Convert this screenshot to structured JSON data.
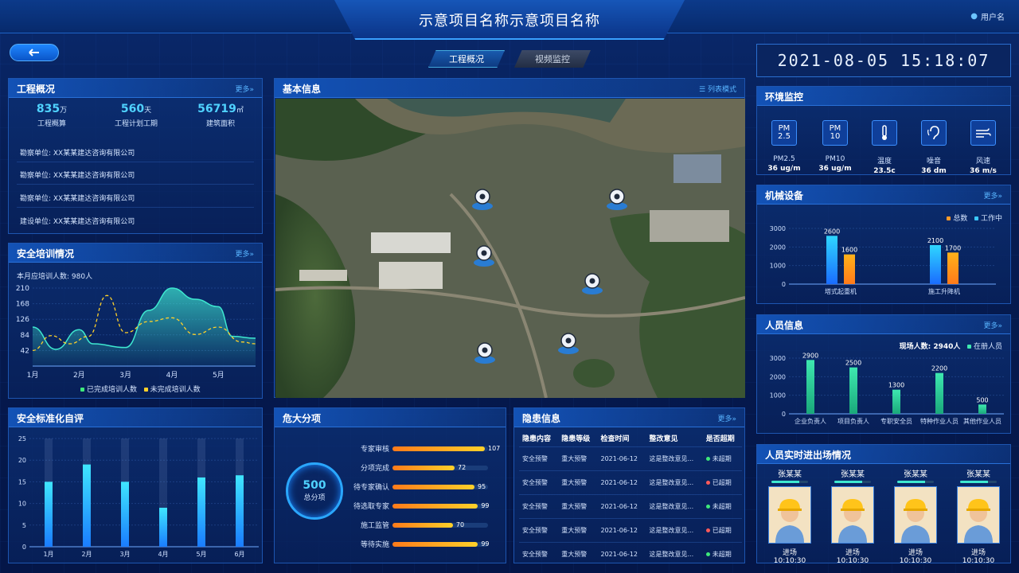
{
  "header": {
    "title": "示意项目名称示意项目名称",
    "user": "用户名"
  },
  "nav": {
    "tab_overview": "工程概况",
    "tab_video": "视频监控"
  },
  "clock": "2021-08-05 15:18:07",
  "overview": {
    "title": "工程概况",
    "more": "更多»",
    "stats": [
      {
        "value": "835",
        "unit": "万",
        "label": "工程概算"
      },
      {
        "value": "560",
        "unit": "天",
        "label": "工程计划工期"
      },
      {
        "value": "56719",
        "unit": "㎡",
        "label": "建筑面积"
      }
    ],
    "rows": [
      "勘察单位:  XX某某建达咨询有限公司",
      "勘察单位:  XX某某建达咨询有限公司",
      "勘察单位:  XX某某建达咨询有限公司",
      "建设单位:  XX某某建达咨询有限公司"
    ]
  },
  "training": {
    "title": "安全培训情况",
    "more": "更多»",
    "note": "本月应培训人数:  980人",
    "legend_done": "已完成培训人数",
    "legend_todo": "未完成培训人数"
  },
  "map": {
    "title": "基本信息",
    "list_mode": "列表模式"
  },
  "env": {
    "title": "环境监控",
    "items": [
      {
        "icon": "PM 2.5",
        "label": "PM2.5",
        "value": "36 ug/m"
      },
      {
        "icon": "PM 10",
        "label": "PM10",
        "value": "36 ug/m"
      },
      {
        "icon": "thermometer-icon",
        "label": "温度",
        "value": "23.5c"
      },
      {
        "icon": "ear-icon",
        "label": "噪音",
        "value": "36 dm"
      },
      {
        "icon": "wind-icon",
        "label": "风速",
        "value": "36 m/s"
      }
    ]
  },
  "machinery": {
    "title": "机械设备",
    "more": "更多»",
    "legend_total": "总数",
    "legend_working": "工作中"
  },
  "personnel": {
    "title": "人员信息",
    "more": "更多»",
    "onsite": "现场人数:  2940人",
    "legend": "在册人员"
  },
  "standard": {
    "title": "安全标准化自评"
  },
  "danger": {
    "title": "危大分项",
    "total_value": "500",
    "total_label": "总分项",
    "items": [
      {
        "label": "专家审核",
        "value": 107
      },
      {
        "label": "分项完成",
        "value": 72
      },
      {
        "label": "待专家确认",
        "value": 95
      },
      {
        "label": "待选取专家",
        "value": 99
      },
      {
        "label": "施工监管",
        "value": 70
      },
      {
        "label": "等待实施",
        "value": 99
      }
    ]
  },
  "hazard": {
    "title": "隐患信息",
    "more": "更多»",
    "headers": [
      "隐患内容",
      "隐患等级",
      "检查时间",
      "整改意见",
      "是否超期"
    ],
    "rows": [
      [
        "安全预警",
        "重大预警",
        "2021-06-12",
        "这是整改意见...",
        "未超期"
      ],
      [
        "安全预警",
        "重大预警",
        "2021-06-12",
        "这是整改意见...",
        "已超期"
      ],
      [
        "安全预警",
        "重大预警",
        "2021-06-12",
        "这是整改意见...",
        "未超期"
      ],
      [
        "安全预警",
        "重大预警",
        "2021-06-12",
        "这是整改意见...",
        "已超期"
      ],
      [
        "安全预警",
        "重大预警",
        "2021-06-12",
        "这是整改意见...",
        "未超期"
      ]
    ]
  },
  "entry": {
    "title": "人员实时进出场情况",
    "people": [
      {
        "name": "张某某",
        "event": "进场 10:10:30"
      },
      {
        "name": "张某某",
        "event": "进场 10:10:30"
      },
      {
        "name": "张某某",
        "event": "进场 10:10:30"
      },
      {
        "name": "张某某",
        "event": "进场 10:10:30"
      }
    ]
  },
  "colors": {
    "accent": "#39a0ff",
    "cyan": "#3ee8d0",
    "orange": "#ff9a2a",
    "green": "#3ee87a",
    "red": "#ff5a5a"
  },
  "chart_data": [
    {
      "type": "area",
      "x": [
        "1月",
        "2月",
        "3月",
        "4月",
        "5月"
      ],
      "xlim": [
        1,
        5.8
      ],
      "yticks": [
        42,
        84,
        126,
        168,
        210
      ],
      "ylim": [
        0,
        210
      ],
      "series": [
        {
          "name": "已完成培训人数",
          "points": [
            [
              1,
              105
            ],
            [
              1.5,
              45
            ],
            [
              2,
              98
            ],
            [
              2.3,
              60
            ],
            [
              3,
              50
            ],
            [
              3.5,
              150
            ],
            [
              4,
              210
            ],
            [
              4.5,
              180
            ],
            [
              5,
              160
            ],
            [
              5.3,
              80
            ],
            [
              5.8,
              75
            ]
          ]
        },
        {
          "name": "未完成培训人数",
          "points": [
            [
              1,
              42
            ],
            [
              1.4,
              82
            ],
            [
              1.8,
              60
            ],
            [
              2.2,
              80
            ],
            [
              2.6,
              190
            ],
            [
              3,
              90
            ],
            [
              3.5,
              120
            ],
            [
              4,
              130
            ],
            [
              4.5,
              85
            ],
            [
              5,
              105
            ],
            [
              5.5,
              65
            ],
            [
              5.8,
              60
            ]
          ]
        }
      ]
    },
    {
      "type": "bar",
      "categories": [
        "塔式起重机",
        "施工升降机"
      ],
      "ylim": [
        0,
        3000
      ],
      "yticks": [
        0,
        1000,
        2000,
        3000
      ],
      "series": [
        {
          "name": "总数",
          "values": [
            2600,
            2100
          ]
        },
        {
          "name": "工作中",
          "values": [
            1600,
            1700
          ]
        }
      ]
    },
    {
      "type": "bar",
      "categories": [
        "企业负责人",
        "项目负责人",
        "专职安全员",
        "特种作业人员",
        "其他作业人员"
      ],
      "ylim": [
        0,
        3000
      ],
      "yticks": [
        0,
        1000,
        2000,
        3000
      ],
      "series": [
        {
          "name": "在册人员",
          "values": [
            2900,
            2500,
            1300,
            2200,
            500
          ]
        }
      ]
    },
    {
      "type": "bar",
      "categories": [
        "1月",
        "2月",
        "3月",
        "4月",
        "5月",
        "6月"
      ],
      "ylim": [
        0,
        25
      ],
      "yticks": [
        0,
        5,
        10,
        15,
        20,
        25
      ],
      "values": [
        15,
        19,
        15,
        9,
        16,
        16.5
      ]
    }
  ]
}
